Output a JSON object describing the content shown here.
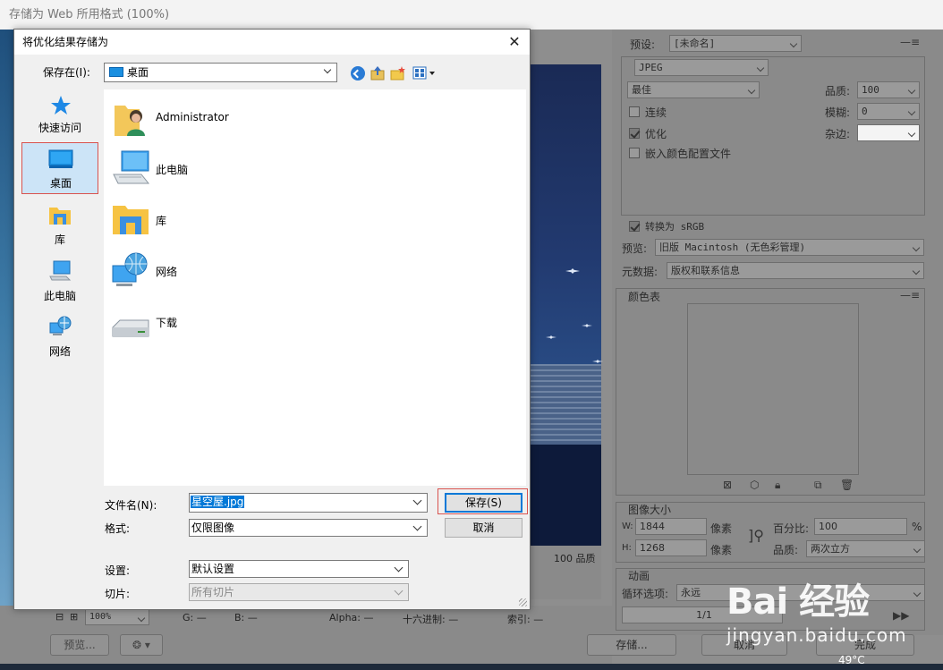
{
  "parent_window": {
    "title": "存储为 Web 所用格式 (100%)",
    "preview_quality": "100 品质",
    "taskbar_temp": "49°C"
  },
  "settings_panel": {
    "preset_label": "预设:",
    "preset_value": "[未命名]",
    "format_value": "JPEG",
    "quality_level": "最佳",
    "quality_label": "品质:",
    "quality_value": "100",
    "progressive_label": "连续",
    "blur_label": "模糊:",
    "blur_value": "0",
    "optimized_label": "优化",
    "matte_label": "杂边:",
    "embed_profile_label": "嵌入颜色配置文件",
    "convert_srgb_label": "转换为 sRGB",
    "preview_label": "预览:",
    "preview_value": "旧版 Macintosh (无色彩管理)",
    "metadata_label": "元数据:",
    "metadata_value": "版权和联系信息",
    "color_table_label": "颜色表",
    "image_size_label": "图像大小",
    "width_label": "W:",
    "width_value": "1844",
    "height_label": "H:",
    "height_value": "1268",
    "pixels_unit": "像素",
    "percent_label": "百分比:",
    "percent_value": "100",
    "percent_unit": "%",
    "resample_label": "品质:",
    "resample_value": "两次立方",
    "animation_label": "动画",
    "loop_label": "循环选项:",
    "loop_value": "永远",
    "frame_counter": "1/1"
  },
  "status_bar": {
    "zoom": "100%",
    "g_label": "G: —",
    "b_label": "B: —",
    "alpha_label": "Alpha: —",
    "hex_label": "十六进制: —",
    "index_label": "索引: —",
    "preview_btn": "预览...",
    "save_btn": "存储...",
    "cancel_btn": "取消",
    "done_btn": "完成"
  },
  "dialog": {
    "title": "将优化结果存储为",
    "save_in_label": "保存在(I):",
    "save_in_value": "桌面",
    "places": [
      "快速访问",
      "桌面",
      "库",
      "此电脑",
      "网络"
    ],
    "files": [
      "Administrator",
      "此电脑",
      "库",
      "网络",
      "下载"
    ],
    "filename_label": "文件名(N):",
    "filename_value": "星空屋.jpg",
    "format_label": "格式:",
    "format_value": "仅限图像",
    "settings_label": "设置:",
    "settings_value": "默认设置",
    "slices_label": "切片:",
    "slices_value": "所有切片",
    "save_button": "保存(S)",
    "cancel_button": "取消"
  },
  "watermark": {
    "logo": "Bai 经验",
    "url": "jingyan.baidu.com"
  }
}
